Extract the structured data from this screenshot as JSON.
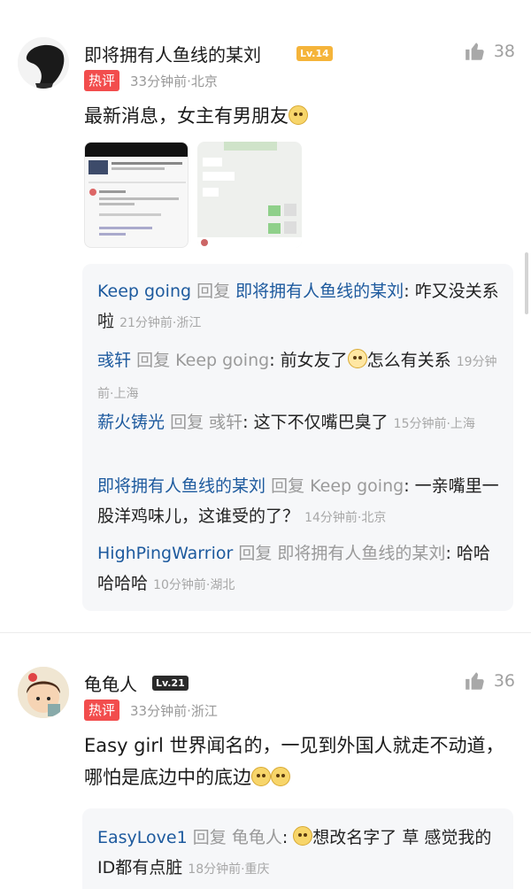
{
  "comments": [
    {
      "username": "即将拥有人鱼线的某刘",
      "level": "Lv.14",
      "hot_badge": "热评",
      "meta": "33分钟前·北京",
      "likes": "38",
      "text": "最新消息，女主有男朋友",
      "replies": [
        {
          "user": "Keep going",
          "reply_word": "回复",
          "to": "即将拥有人鱼线的某刘",
          "text": "咋又没关系啦",
          "time": "21分钟前·浙江"
        },
        {
          "user": "彧轩",
          "reply_word": "回复",
          "to": "Keep going",
          "text": "前女友了",
          "text2": "怎么有关系",
          "time": "19分钟前·上海"
        },
        {
          "user": "薪火铸光",
          "reply_word": "回复",
          "to": "彧轩",
          "text": "这下不仅嘴巴臭了",
          "time": "15分钟前·上海"
        },
        {
          "user": "即将拥有人鱼线的某刘",
          "reply_word": "回复",
          "to": "Keep going",
          "text": "一亲嘴里一股洋鸡味儿，这谁受的了？",
          "time": "14分钟前·北京"
        },
        {
          "user": "HighPingWarrior",
          "reply_word": "回复",
          "to": "即将拥有人鱼线的某刘",
          "text": "哈哈哈哈哈",
          "time": "10分钟前·湖北"
        }
      ]
    },
    {
      "username": "龟龟人",
      "level": "Lv.21",
      "hot_badge": "热评",
      "meta": "33分钟前·浙江",
      "likes": "36",
      "text": "Easy girl 世界闻名的，一见到外国人就走不动道，哪怕是底边中的底边",
      "replies": [
        {
          "user": "EasyLove1",
          "reply_word": "回复",
          "to": "龟龟人",
          "text": "想改名字了 草 感觉我的ID都有点脏",
          "time": "18分钟前·重庆"
        }
      ]
    }
  ]
}
